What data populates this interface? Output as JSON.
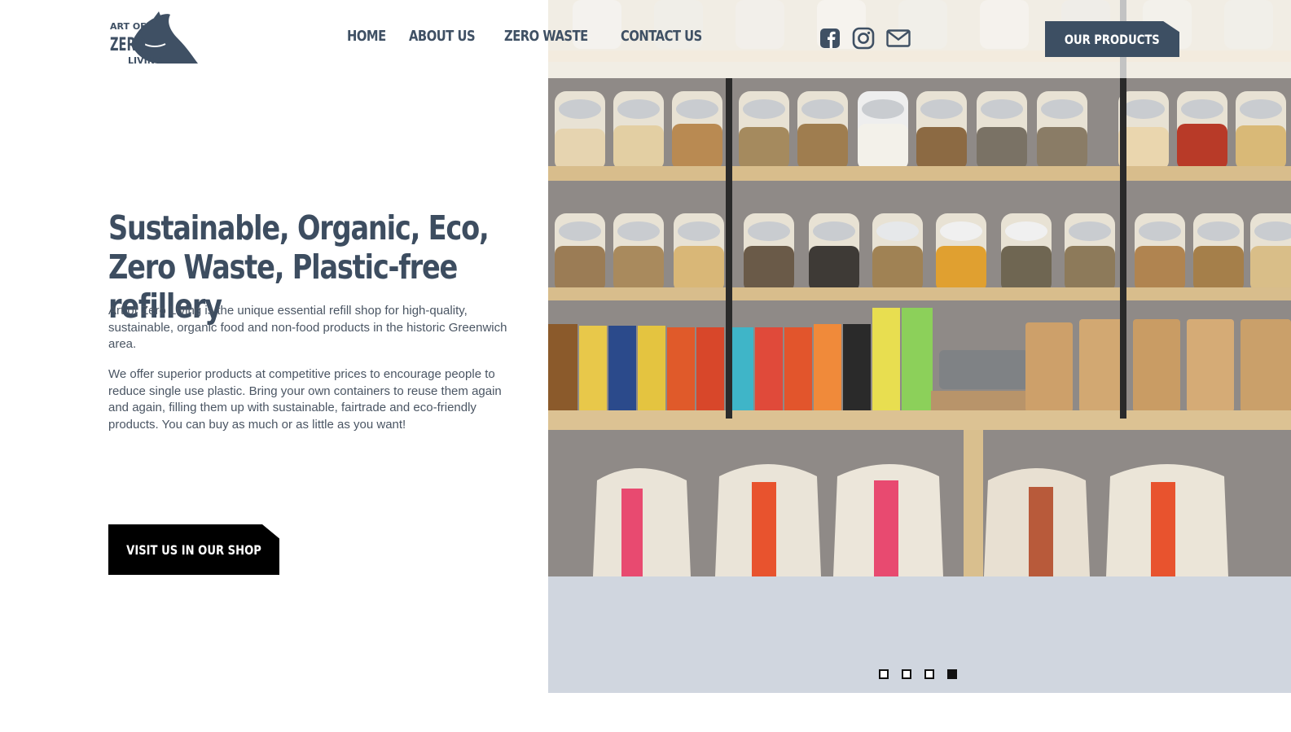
{
  "brand": {
    "logo_line1": "ART OF",
    "logo_line2": "ZERO",
    "logo_line3": "LIVING",
    "logo_icon": "whale-icon"
  },
  "nav": {
    "items": [
      {
        "label": "HOME"
      },
      {
        "label": "ABOUT US"
      },
      {
        "label": "ZERO WASTE"
      },
      {
        "label": "CONTACT US"
      }
    ]
  },
  "social": {
    "icons": [
      "facebook-icon",
      "instagram-icon",
      "mail-icon"
    ]
  },
  "header_cta": {
    "label": "OUR PRODUCTS"
  },
  "hero": {
    "headline": "Sustainable, Organic, Eco, Zero Waste, Plastic-free refillery",
    "paragraph1": "Art of Zero Living is the unique essential refill shop for high-quality, sustainable, organic food and non-food products in the historic Greenwich area.",
    "paragraph2": "We offer superior products at competitive prices to encourage people to reduce single use plastic. Bring your own containers to reuse them again and again, filling them up with sustainable, fairtrade and eco-friendly products. You can buy as much or as little as you want!",
    "cta_label": "VISIT US IN OUR SHOP"
  },
  "slider": {
    "slide_count": 4,
    "active_index": 4
  },
  "colors": {
    "brand_dark": "#3d4f63",
    "text": "#4a5563",
    "panel": "#d0d6df",
    "cta_black": "#000000"
  }
}
